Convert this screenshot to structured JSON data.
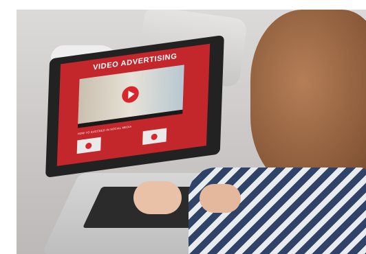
{
  "scene": {
    "screen": {
      "title": "VIDEO ADVERTISING",
      "subheading": "HOW TO SUCCEED IN SOCIAL MEDIA"
    }
  },
  "colors": {
    "screen_red": "#c3262b",
    "play_red": "#d8262d",
    "sweater_navy": "#2f4267"
  },
  "icons": [
    "play-icon"
  ]
}
